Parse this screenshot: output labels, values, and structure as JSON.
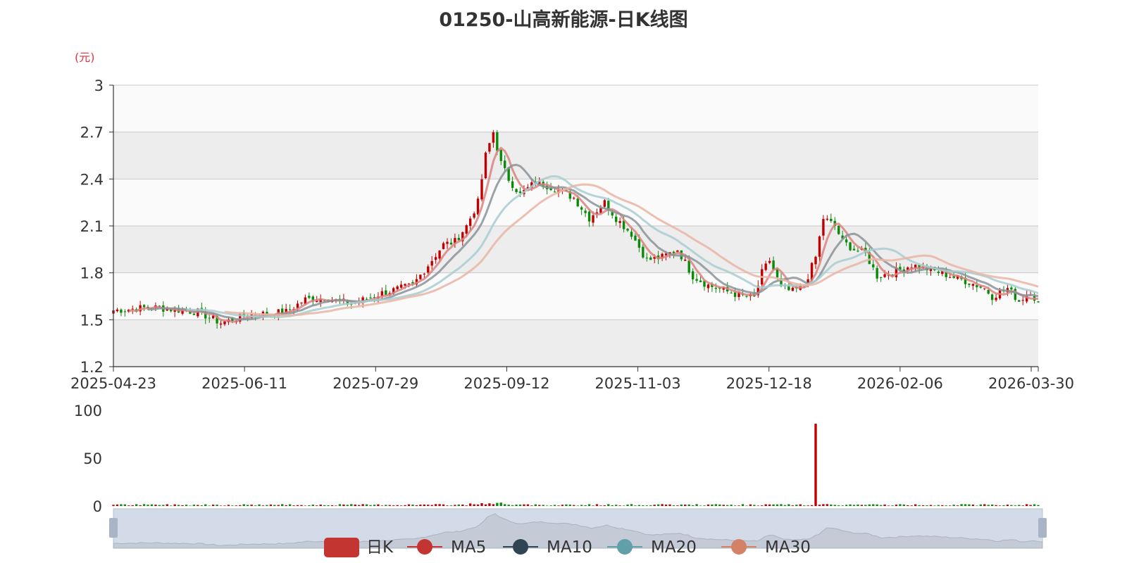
{
  "chart_data": {
    "type": "candlestick",
    "title": "01250-山高新能源-日K线图",
    "y_unit": "(元)",
    "price_axis": {
      "ylim": [
        1.2,
        3.0
      ],
      "ticks": [
        "1.2",
        "1.5",
        "1.8",
        "2.1",
        "2.4",
        "2.7",
        "3"
      ]
    },
    "volume_axis": {
      "ylim": [
        0,
        100
      ],
      "ticks": [
        "0",
        "50",
        "100"
      ]
    },
    "x_ticks": [
      "2025-04-23",
      "2025-06-11",
      "2025-07-29",
      "2025-09-12",
      "2025-11-03",
      "2025-12-18",
      "2026-02-06",
      "2026-03-30"
    ],
    "grid": true,
    "legend": {
      "position": "bottom",
      "items": [
        {
          "name": "日K",
          "color": "#c23531"
        },
        {
          "name": "MA5",
          "color": "#c23531"
        },
        {
          "name": "MA10",
          "color": "#2f4554"
        },
        {
          "name": "MA20",
          "color": "#61a0a8"
        },
        {
          "name": "MA30",
          "color": "#d48265"
        }
      ]
    },
    "colors": {
      "up": "#c00000",
      "down": "#0a8a0a",
      "ma5": "#d9837f",
      "ma10": "#8a9299",
      "ma20": "#a8ccd0",
      "ma30": "#e8b5a5"
    },
    "trading_days": 242,
    "closing_price_anchors": [
      {
        "day": 0,
        "close": 1.56
      },
      {
        "day": 10,
        "close": 1.58
      },
      {
        "day": 22,
        "close": 1.55
      },
      {
        "day": 28,
        "close": 1.48
      },
      {
        "day": 35,
        "close": 1.53
      },
      {
        "day": 45,
        "close": 1.55
      },
      {
        "day": 50,
        "close": 1.63
      },
      {
        "day": 55,
        "close": 1.64
      },
      {
        "day": 62,
        "close": 1.6
      },
      {
        "day": 70,
        "close": 1.67
      },
      {
        "day": 78,
        "close": 1.72
      },
      {
        "day": 82,
        "close": 1.85
      },
      {
        "day": 86,
        "close": 1.98
      },
      {
        "day": 89,
        "close": 2.0
      },
      {
        "day": 92,
        "close": 2.1
      },
      {
        "day": 95,
        "close": 2.25
      },
      {
        "day": 97,
        "close": 2.55
      },
      {
        "day": 99,
        "close": 2.7
      },
      {
        "day": 101,
        "close": 2.5
      },
      {
        "day": 103,
        "close": 2.4
      },
      {
        "day": 106,
        "close": 2.3
      },
      {
        "day": 110,
        "close": 2.38
      },
      {
        "day": 114,
        "close": 2.35
      },
      {
        "day": 120,
        "close": 2.28
      },
      {
        "day": 124,
        "close": 2.15
      },
      {
        "day": 128,
        "close": 2.25
      },
      {
        "day": 131,
        "close": 2.15
      },
      {
        "day": 135,
        "close": 2.05
      },
      {
        "day": 139,
        "close": 1.88
      },
      {
        "day": 143,
        "close": 1.9
      },
      {
        "day": 147,
        "close": 1.95
      },
      {
        "day": 151,
        "close": 1.78
      },
      {
        "day": 155,
        "close": 1.72
      },
      {
        "day": 160,
        "close": 1.68
      },
      {
        "day": 164,
        "close": 1.65
      },
      {
        "day": 167,
        "close": 1.64
      },
      {
        "day": 169,
        "close": 1.8
      },
      {
        "day": 171,
        "close": 1.88
      },
      {
        "day": 174,
        "close": 1.7
      },
      {
        "day": 177,
        "close": 1.68
      },
      {
        "day": 180,
        "close": 1.72
      },
      {
        "day": 183,
        "close": 1.9
      },
      {
        "day": 185,
        "close": 2.15
      },
      {
        "day": 188,
        "close": 2.1
      },
      {
        "day": 190,
        "close": 2.0
      },
      {
        "day": 193,
        "close": 1.95
      },
      {
        "day": 196,
        "close": 1.92
      },
      {
        "day": 199,
        "close": 1.78
      },
      {
        "day": 203,
        "close": 1.8
      },
      {
        "day": 208,
        "close": 1.85
      },
      {
        "day": 213,
        "close": 1.82
      },
      {
        "day": 218,
        "close": 1.78
      },
      {
        "day": 223,
        "close": 1.74
      },
      {
        "day": 227,
        "close": 1.7
      },
      {
        "day": 229,
        "close": 1.65
      },
      {
        "day": 233,
        "close": 1.7
      },
      {
        "day": 236,
        "close": 1.62
      },
      {
        "day": 239,
        "close": 1.68
      },
      {
        "day": 241,
        "close": 1.6
      }
    ],
    "volume_spike": {
      "day": 183,
      "value": 86
    }
  }
}
